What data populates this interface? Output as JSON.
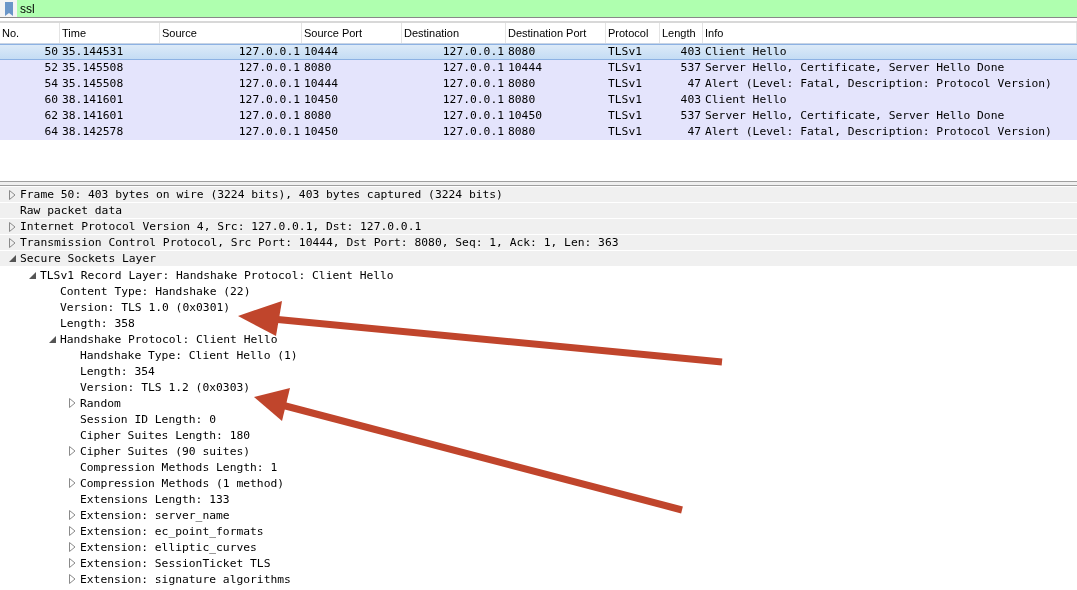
{
  "filter": {
    "value": "ssl"
  },
  "packet_list": {
    "columns": [
      "No.",
      "Time",
      "Source",
      "Source Port",
      "Destination",
      "Destination Port",
      "Protocol",
      "Length",
      "Info"
    ],
    "rows": [
      {
        "selected": true,
        "cells": [
          "50",
          "35.144531",
          "127.0.0.1",
          "10444",
          "127.0.0.1",
          "8080",
          "TLSv1",
          "403",
          "Client Hello"
        ]
      },
      {
        "selected": false,
        "cells": [
          "52",
          "35.145508",
          "127.0.0.1",
          "8080",
          "127.0.0.1",
          "10444",
          "TLSv1",
          "537",
          "Server Hello, Certificate, Server Hello Done"
        ]
      },
      {
        "selected": false,
        "cells": [
          "54",
          "35.145508",
          "127.0.0.1",
          "10444",
          "127.0.0.1",
          "8080",
          "TLSv1",
          "47",
          "Alert (Level: Fatal, Description: Protocol Version)"
        ]
      },
      {
        "selected": false,
        "cells": [
          "60",
          "38.141601",
          "127.0.0.1",
          "10450",
          "127.0.0.1",
          "8080",
          "TLSv1",
          "403",
          "Client Hello"
        ]
      },
      {
        "selected": false,
        "cells": [
          "62",
          "38.141601",
          "127.0.0.1",
          "8080",
          "127.0.0.1",
          "10450",
          "TLSv1",
          "537",
          "Server Hello, Certificate, Server Hello Done"
        ]
      },
      {
        "selected": false,
        "cells": [
          "64",
          "38.142578",
          "127.0.0.1",
          "10450",
          "127.0.0.1",
          "8080",
          "TLSv1",
          "47",
          "Alert (Level: Fatal, Description: Protocol Version)"
        ]
      }
    ]
  },
  "packet_details": [
    {
      "label": "Frame 50: 403 bytes on wire (3224 bits), 403 bytes captured (3224 bits)",
      "expanded": false
    },
    {
      "label": "Raw packet data"
    },
    {
      "label": "Internet Protocol Version 4, Src: 127.0.0.1, Dst: 127.0.0.1",
      "expanded": false
    },
    {
      "label": "Transmission Control Protocol, Src Port: 10444, Dst Port: 8080, Seq: 1, Ack: 1, Len: 363",
      "expanded": false
    },
    {
      "label": "Secure Sockets Layer",
      "expanded": true,
      "children": [
        {
          "label": "TLSv1 Record Layer: Handshake Protocol: Client Hello",
          "expanded": true,
          "children": [
            {
              "label": "Content Type: Handshake (22)"
            },
            {
              "label": "Version: TLS 1.0 (0x0301)"
            },
            {
              "label": "Length: 358"
            },
            {
              "label": "Handshake Protocol: Client Hello",
              "expanded": true,
              "children": [
                {
                  "label": "Handshake Type: Client Hello (1)"
                },
                {
                  "label": "Length: 354"
                },
                {
                  "label": "Version: TLS 1.2 (0x0303)"
                },
                {
                  "label": "Random",
                  "expanded": false
                },
                {
                  "label": "Session ID Length: 0"
                },
                {
                  "label": "Cipher Suites Length: 180"
                },
                {
                  "label": "Cipher Suites (90 suites)",
                  "expanded": false
                },
                {
                  "label": "Compression Methods Length: 1"
                },
                {
                  "label": "Compression Methods (1 method)",
                  "expanded": false
                },
                {
                  "label": "Extensions Length: 133"
                },
                {
                  "label": "Extension: server_name",
                  "expanded": false
                },
                {
                  "label": "Extension: ec_point_formats",
                  "expanded": false
                },
                {
                  "label": "Extension: elliptic_curves",
                  "expanded": false
                },
                {
                  "label": "Extension: SessionTicket TLS",
                  "expanded": false
                },
                {
                  "label": "Extension: signature algorithms",
                  "expanded": false
                }
              ]
            }
          ]
        }
      ]
    }
  ]
}
